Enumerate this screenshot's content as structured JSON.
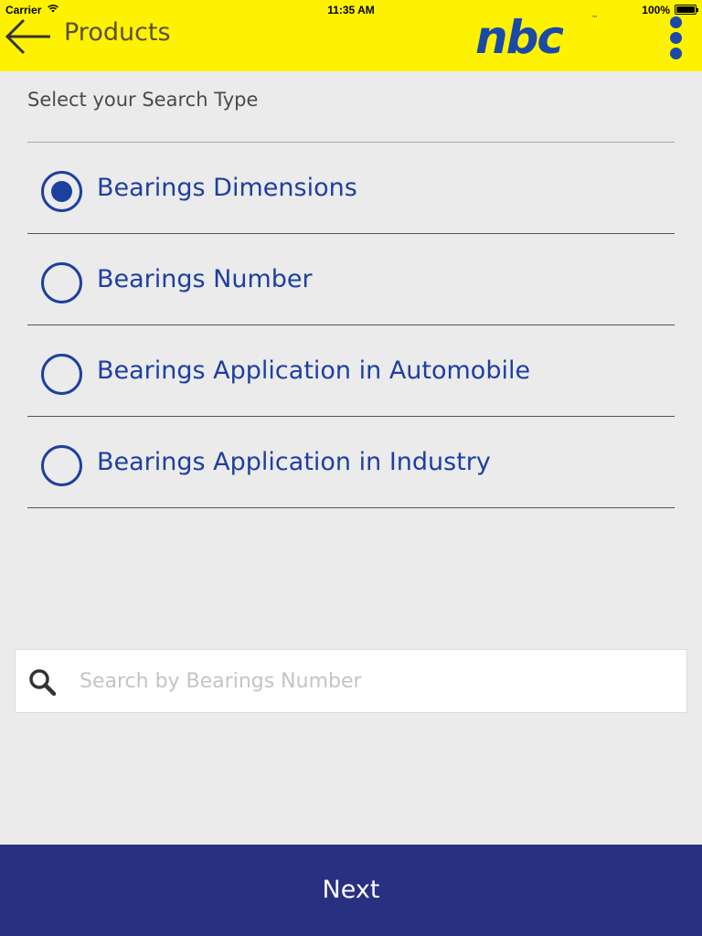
{
  "status_bar": {
    "carrier": "Carrier",
    "time": "11:35 AM",
    "battery": "100%"
  },
  "header": {
    "title": "Products",
    "logo_text": "nbc",
    "logo_tm": "™",
    "back_icon": "arrow-left-icon",
    "menu_icon": "more-vertical-icon"
  },
  "search_type": {
    "heading": "Select your Search Type",
    "options": [
      {
        "label": "Bearings Dimensions",
        "selected": true
      },
      {
        "label": "Bearings Number",
        "selected": false
      },
      {
        "label": "Bearings Application in Automobile",
        "selected": false
      },
      {
        "label": "Bearings Application in Industry",
        "selected": false
      }
    ]
  },
  "search": {
    "placeholder": "Search by Bearings Number",
    "value": "",
    "icon": "search-icon"
  },
  "footer": {
    "next_label": "Next"
  },
  "colors": {
    "header_bg": "#fff200",
    "accent": "#1d3fa0",
    "footer_bg": "#283081",
    "page_bg": "#ebebeb"
  }
}
